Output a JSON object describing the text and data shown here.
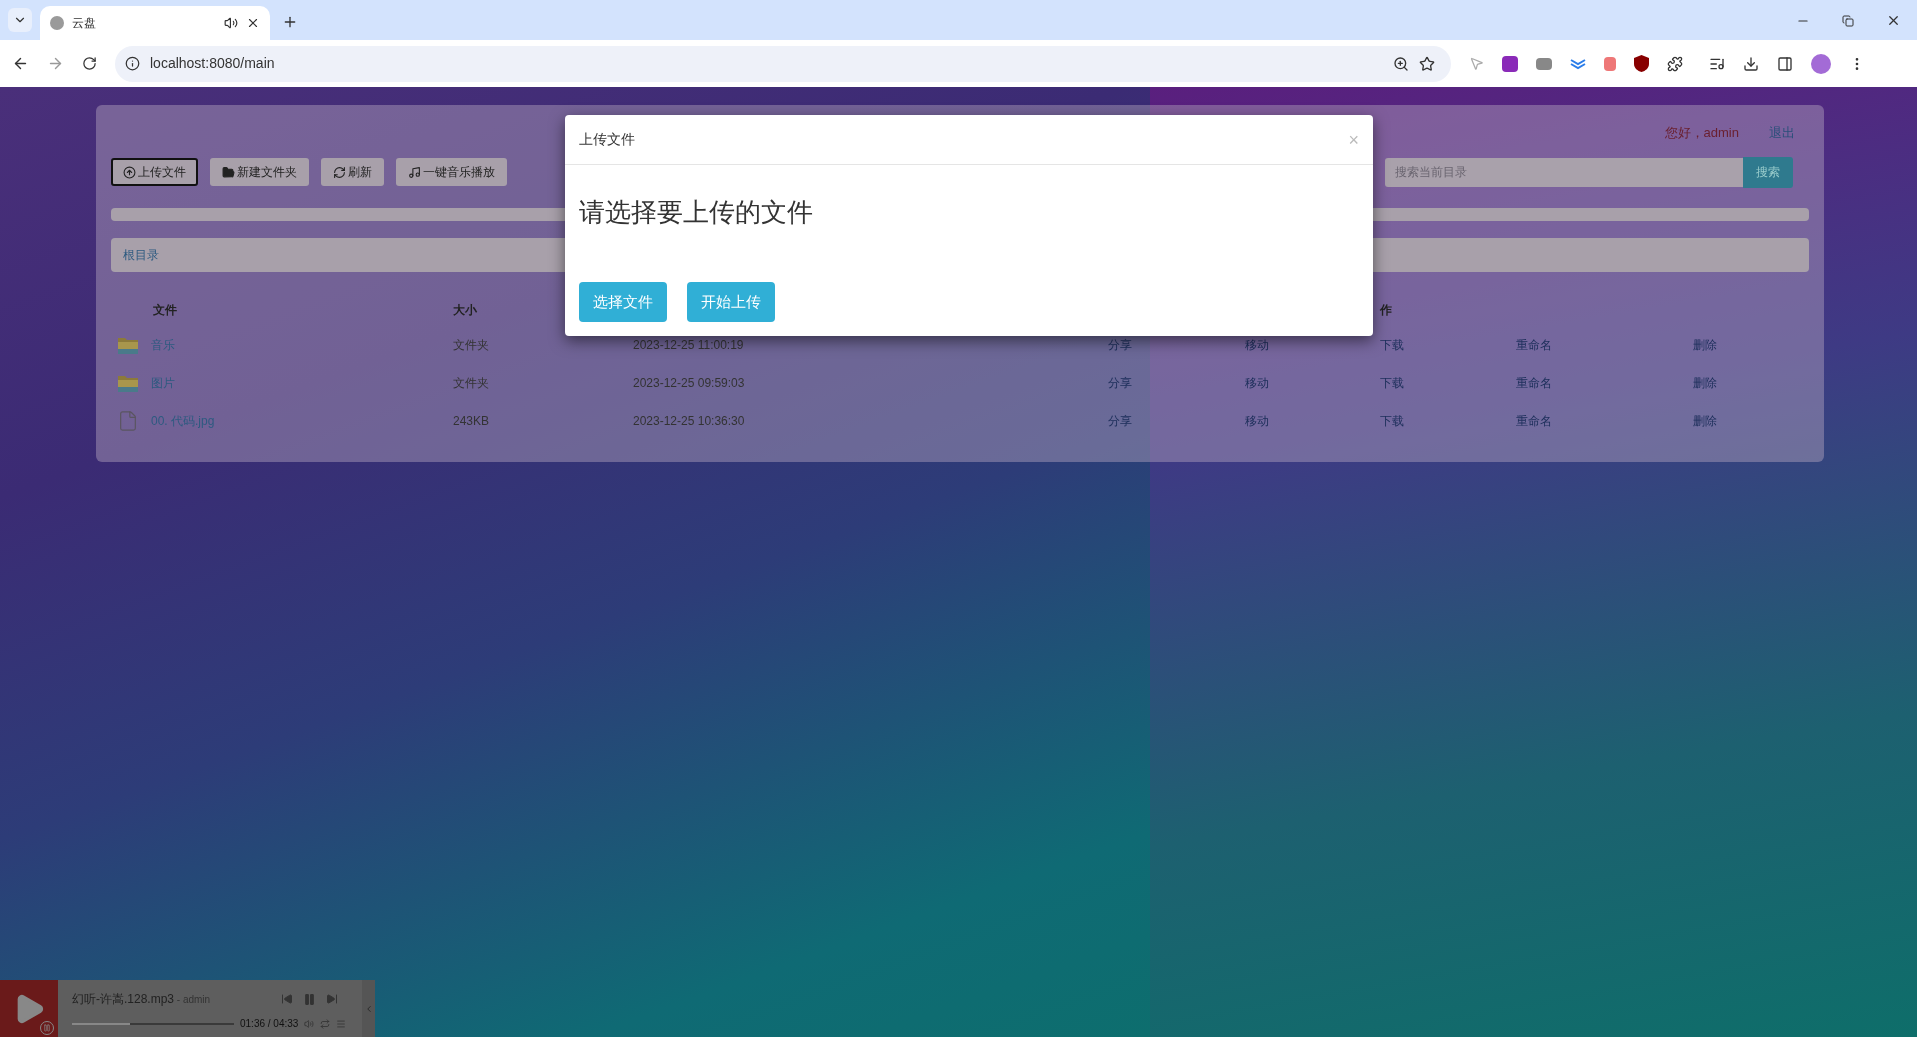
{
  "browser": {
    "tab_title": "云盘",
    "tab_audio": true,
    "url": "localhost:8080/main"
  },
  "header": {
    "greeting": "您好，admin",
    "logout": "退出"
  },
  "toolbar": [
    {
      "kind": "upload",
      "label": "上传文件",
      "focused": true
    },
    {
      "kind": "folder",
      "label": "新建文件夹",
      "focused": false
    },
    {
      "kind": "refresh",
      "label": "刷新",
      "focused": false
    },
    {
      "kind": "music",
      "label": "一键音乐播放",
      "focused": false
    }
  ],
  "search": {
    "placeholder": "搜索当前目录",
    "button": "搜索"
  },
  "breadcrumb": "根目录",
  "table": {
    "columns": [
      {
        "label": "文件"
      },
      {
        "label": "大小"
      },
      {
        "label": "作"
      }
    ],
    "rows": [
      {
        "kind": "folder",
        "name": "音乐",
        "size": "文件夹",
        "modified": "2023-12-25 11:00:19",
        "actions": [
          "分享",
          "移动",
          "下载",
          "重命名",
          "删除"
        ]
      },
      {
        "kind": "folder",
        "name": "图片",
        "size": "文件夹",
        "modified": "2023-12-25 09:59:03",
        "actions": [
          "分享",
          "移动",
          "下载",
          "重命名",
          "删除"
        ]
      },
      {
        "kind": "file",
        "name": "00. 代码.jpg",
        "size": "243KB",
        "modified": "2023-12-25 10:36:30",
        "actions": [
          "分享",
          "移动",
          "下载",
          "重命名",
          "删除"
        ]
      }
    ]
  },
  "modal": {
    "title": "上传文件",
    "close": "×",
    "heading": "请选择要上传的文件",
    "buttons": [
      "选择文件",
      "开始上传"
    ]
  },
  "player": {
    "title": "幻听-许嵩.128.mp3",
    "artist": " - admin",
    "time": "01:36 / 04:33",
    "playing": true,
    "level": 0.36
  }
}
